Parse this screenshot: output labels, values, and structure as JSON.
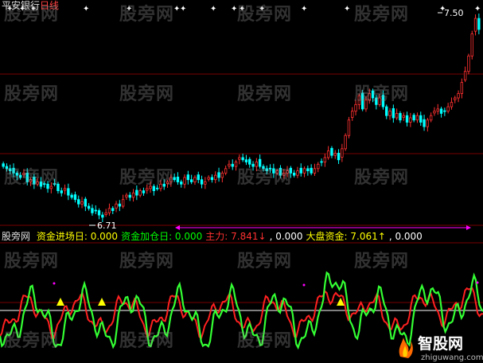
{
  "header": {
    "stock": "平安银行",
    "period": "日线"
  },
  "indicator_bar": {
    "source": "股旁网",
    "items": [
      {
        "label": "资金进场日",
        "value": "0.000",
        "color": "#ffff00"
      },
      {
        "label": "资金加仓日",
        "value": "0.000",
        "color": "#00ff00"
      },
      {
        "label": "主力",
        "value": "7.841↓",
        "color": "#ff3030"
      },
      {
        "label": "",
        "value": "0.000",
        "color": "#ffffff"
      },
      {
        "label": "大盘资金",
        "value": "7.061↑",
        "color": "#ffff00"
      },
      {
        "label": "",
        "value": "0.000",
        "color": "#ffffff"
      }
    ]
  },
  "watermark": "股旁网",
  "logo": {
    "name": "智股网",
    "url": "zhiguwang.com"
  },
  "colors": {
    "up": "#ff3030",
    "down": "#00ffff",
    "green": "#33ff33",
    "red": "#ff2020",
    "grid": "#800000"
  },
  "chart_data": [
    {
      "type": "candlestick",
      "title": "",
      "price_labels": {
        "high": "7.50",
        "low": "6.71"
      },
      "annotations": [
        "star markers along top row"
      ],
      "series": [
        {
          "name": "close",
          "values": [
            6.95,
            6.94,
            6.93,
            6.92,
            6.91,
            6.9,
            6.92,
            6.88,
            6.89,
            6.87,
            6.88,
            6.86,
            6.87,
            6.85,
            6.86,
            6.87,
            6.84,
            6.83,
            6.85,
            6.82,
            6.81,
            6.8,
            6.78,
            6.79,
            6.77,
            6.76,
            6.74,
            6.75,
            6.73,
            6.72,
            6.74,
            6.76,
            6.75,
            6.78,
            6.77,
            6.8,
            6.82,
            6.81,
            6.83,
            6.82,
            6.84,
            6.83,
            6.85,
            6.86,
            6.84,
            6.85,
            6.87,
            6.86,
            6.88,
            6.9,
            6.89,
            6.88,
            6.87,
            6.9,
            6.89,
            6.88,
            6.9,
            6.89,
            6.87,
            6.88,
            6.9,
            6.89,
            6.91,
            6.9,
            6.92,
            6.94,
            6.96,
            6.95,
            6.97,
            6.99,
            6.98,
            6.97,
            6.96,
            6.95,
            6.97,
            6.95,
            6.94,
            6.93,
            6.94,
            6.92,
            6.93,
            6.91,
            6.92,
            6.93,
            6.92,
            6.91,
            6.93,
            6.92,
            6.94,
            6.93,
            6.92,
            6.94,
            6.96,
            6.97,
            6.99,
            7.02,
            7.0,
            7.01,
            6.98,
            7.03,
            7.09,
            7.16,
            7.2,
            7.23,
            7.27,
            7.21,
            7.25,
            7.28,
            7.26,
            7.23,
            7.26,
            7.22,
            7.18,
            7.2,
            7.17,
            7.19,
            7.16,
            7.18,
            7.15,
            7.17,
            7.16,
            7.18,
            7.15,
            7.13,
            7.16,
            7.18,
            7.2,
            7.21,
            7.19,
            7.2,
            7.22,
            7.24,
            7.26,
            7.28,
            7.33,
            7.38,
            7.45,
            7.55,
            7.62,
            7.57
          ]
        }
      ]
    },
    {
      "type": "line",
      "title": "",
      "series": [
        {
          "name": "主力",
          "color": "#ff2020"
        },
        {
          "name": "大盘资金",
          "color": "#33ff33"
        }
      ],
      "markers": [
        "yellow triangle buy signals"
      ]
    }
  ]
}
